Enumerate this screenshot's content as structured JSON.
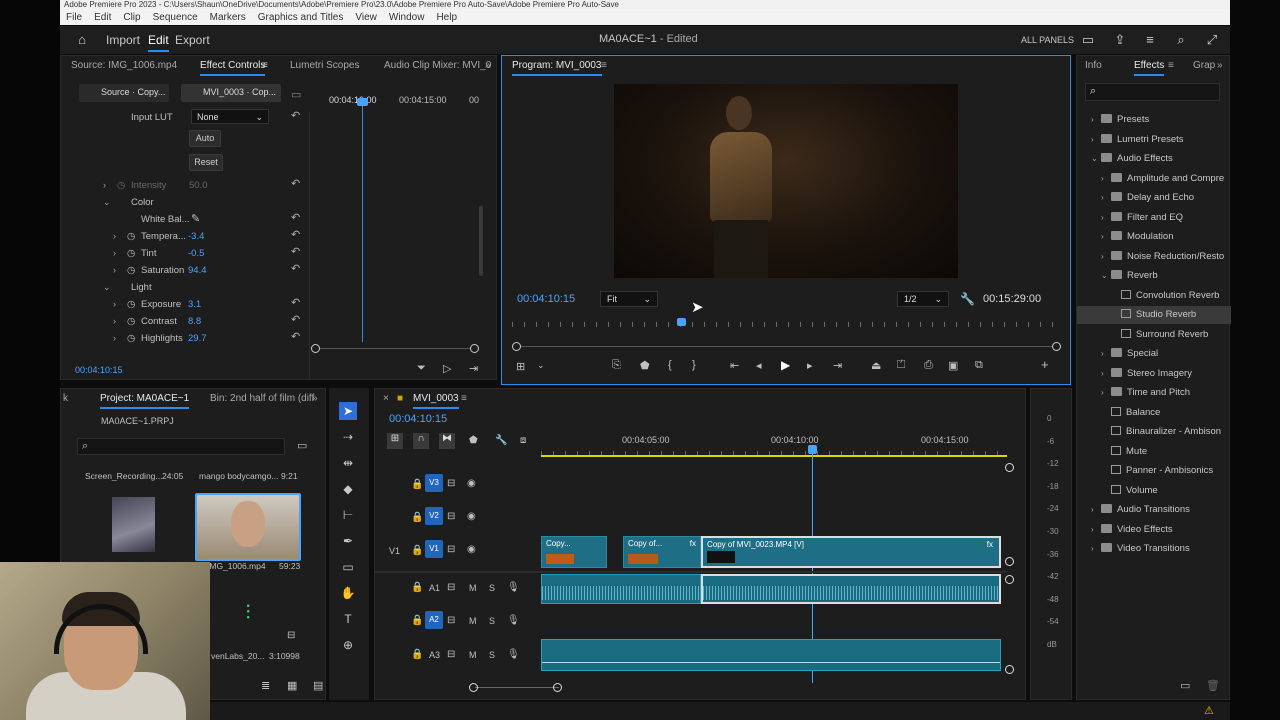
{
  "window": {
    "title": "Adobe Premiere Pro 2023 - C:\\Users\\Shaun\\OneDrive\\Documents\\Adobe\\Premiere Pro\\23.0\\Adobe Premiere Pro Auto-Save\\Adobe Premiere Pro Auto-Save",
    "menu": [
      "File",
      "Edit",
      "Clip",
      "Sequence",
      "Markers",
      "Graphics and Titles",
      "View",
      "Window",
      "Help"
    ]
  },
  "header": {
    "nav": [
      "Import",
      "Edit",
      "Export"
    ],
    "project_title": "MA0ACE~1",
    "edited_label": "- Edited",
    "all_panels": "ALL PANELS"
  },
  "source_panel": {
    "tabs": [
      "Source: IMG_1006.mp4",
      "Effect Controls",
      "Lumetri Scopes",
      "Audio Clip Mixer: MVI_0"
    ],
    "clip_tabs": [
      "Source · Copy...",
      "MVI_0003 · Cop..."
    ],
    "ruler": [
      "00:04:10:00",
      "00:04:15:00",
      "00"
    ],
    "input_lut_label": "Input LUT",
    "input_lut_value": "None",
    "auto_button": "Auto",
    "reset_button": "Reset",
    "intensity_label": "Intensity",
    "intensity_value": "50.0",
    "color_label": "Color",
    "white_balance_label": "White Bal...",
    "params": [
      {
        "label": "Tempera...",
        "value": "-3.4"
      },
      {
        "label": "Tint",
        "value": "-0.5"
      },
      {
        "label": "Saturation",
        "value": "94.4"
      }
    ],
    "light_label": "Light",
    "light_params": [
      {
        "label": "Exposure",
        "value": "3.1"
      },
      {
        "label": "Contrast",
        "value": "8.8"
      },
      {
        "label": "Highlights",
        "value": "29.7"
      }
    ],
    "timecode": "00:04:10:15"
  },
  "program": {
    "tab": "Program: MVI_0003",
    "timecode": "00:04:10:15",
    "fit": "Fit",
    "resolution": "1/2",
    "duration": "00:15:29:00",
    "playhead_fraction": 0.31
  },
  "project": {
    "tabs": [
      "Project: MA0ACE~1",
      "Bin: 2nd half of film (diff"
    ],
    "file": "MA0ACE~1.PRPJ",
    "items": [
      {
        "name": "Screen_Recording...",
        "duration": "24:05"
      },
      {
        "name": "mango bodycamgo...",
        "duration": "9:21"
      },
      {
        "name": "IMG_1006.mp4",
        "duration": "59:23"
      },
      {
        "name": "venLabs_20...",
        "duration": "3:10998"
      }
    ]
  },
  "timeline": {
    "tab": "MVI_0003",
    "timecode": "00:04:10:15",
    "ruler": [
      "00:04:05:00",
      "00:04:10:00",
      "00:04:15:00"
    ],
    "tracks": [
      {
        "name": "V3",
        "kind": "video"
      },
      {
        "name": "V2",
        "kind": "video"
      },
      {
        "name": "V1",
        "kind": "video",
        "source": "V1"
      },
      {
        "name": "A1",
        "kind": "audio"
      },
      {
        "name": "A2",
        "kind": "audio"
      },
      {
        "name": "A3",
        "kind": "audio"
      }
    ],
    "clips": [
      "Copy...",
      "Copy of...",
      "Copy of MVI_0023.MP4 [V]"
    ],
    "fx_label": "fx",
    "m_label": "M",
    "s_label": "S"
  },
  "meters": [
    "0",
    "-6",
    "-12",
    "-18",
    "-24",
    "-30",
    "-36",
    "-42",
    "-48",
    "-54",
    "dB"
  ],
  "effects_panel": {
    "tabs": [
      "Info",
      "Effects",
      "Grap"
    ],
    "items": [
      {
        "label": "Presets",
        "level": 0,
        "kind": "folder"
      },
      {
        "label": "Lumetri Presets",
        "level": 0,
        "kind": "folder"
      },
      {
        "label": "Audio Effects",
        "level": 0,
        "kind": "folder-open"
      },
      {
        "label": "Amplitude and Compre",
        "level": 1,
        "kind": "folder"
      },
      {
        "label": "Delay and Echo",
        "level": 1,
        "kind": "folder"
      },
      {
        "label": "Filter and EQ",
        "level": 1,
        "kind": "folder"
      },
      {
        "label": "Modulation",
        "level": 1,
        "kind": "folder"
      },
      {
        "label": "Noise Reduction/Resto",
        "level": 1,
        "kind": "folder"
      },
      {
        "label": "Reverb",
        "level": 1,
        "kind": "folder-open"
      },
      {
        "label": "Convolution Reverb",
        "level": 2,
        "kind": "effect"
      },
      {
        "label": "Studio Reverb",
        "level": 2,
        "kind": "effect",
        "selected": true
      },
      {
        "label": "Surround Reverb",
        "level": 2,
        "kind": "effect"
      },
      {
        "label": "Special",
        "level": 1,
        "kind": "folder"
      },
      {
        "label": "Stereo Imagery",
        "level": 1,
        "kind": "folder"
      },
      {
        "label": "Time and Pitch",
        "level": 1,
        "kind": "folder"
      },
      {
        "label": "Balance",
        "level": 1,
        "kind": "effect"
      },
      {
        "label": "Binauralizer - Ambison",
        "level": 1,
        "kind": "effect"
      },
      {
        "label": "Mute",
        "level": 1,
        "kind": "effect"
      },
      {
        "label": "Panner - Ambisonics",
        "level": 1,
        "kind": "effect"
      },
      {
        "label": "Volume",
        "level": 1,
        "kind": "effect"
      },
      {
        "label": "Audio Transitions",
        "level": 0,
        "kind": "folder"
      },
      {
        "label": "Video Effects",
        "level": 0,
        "kind": "folder"
      },
      {
        "label": "Video Transitions",
        "level": 0,
        "kind": "folder"
      }
    ]
  }
}
